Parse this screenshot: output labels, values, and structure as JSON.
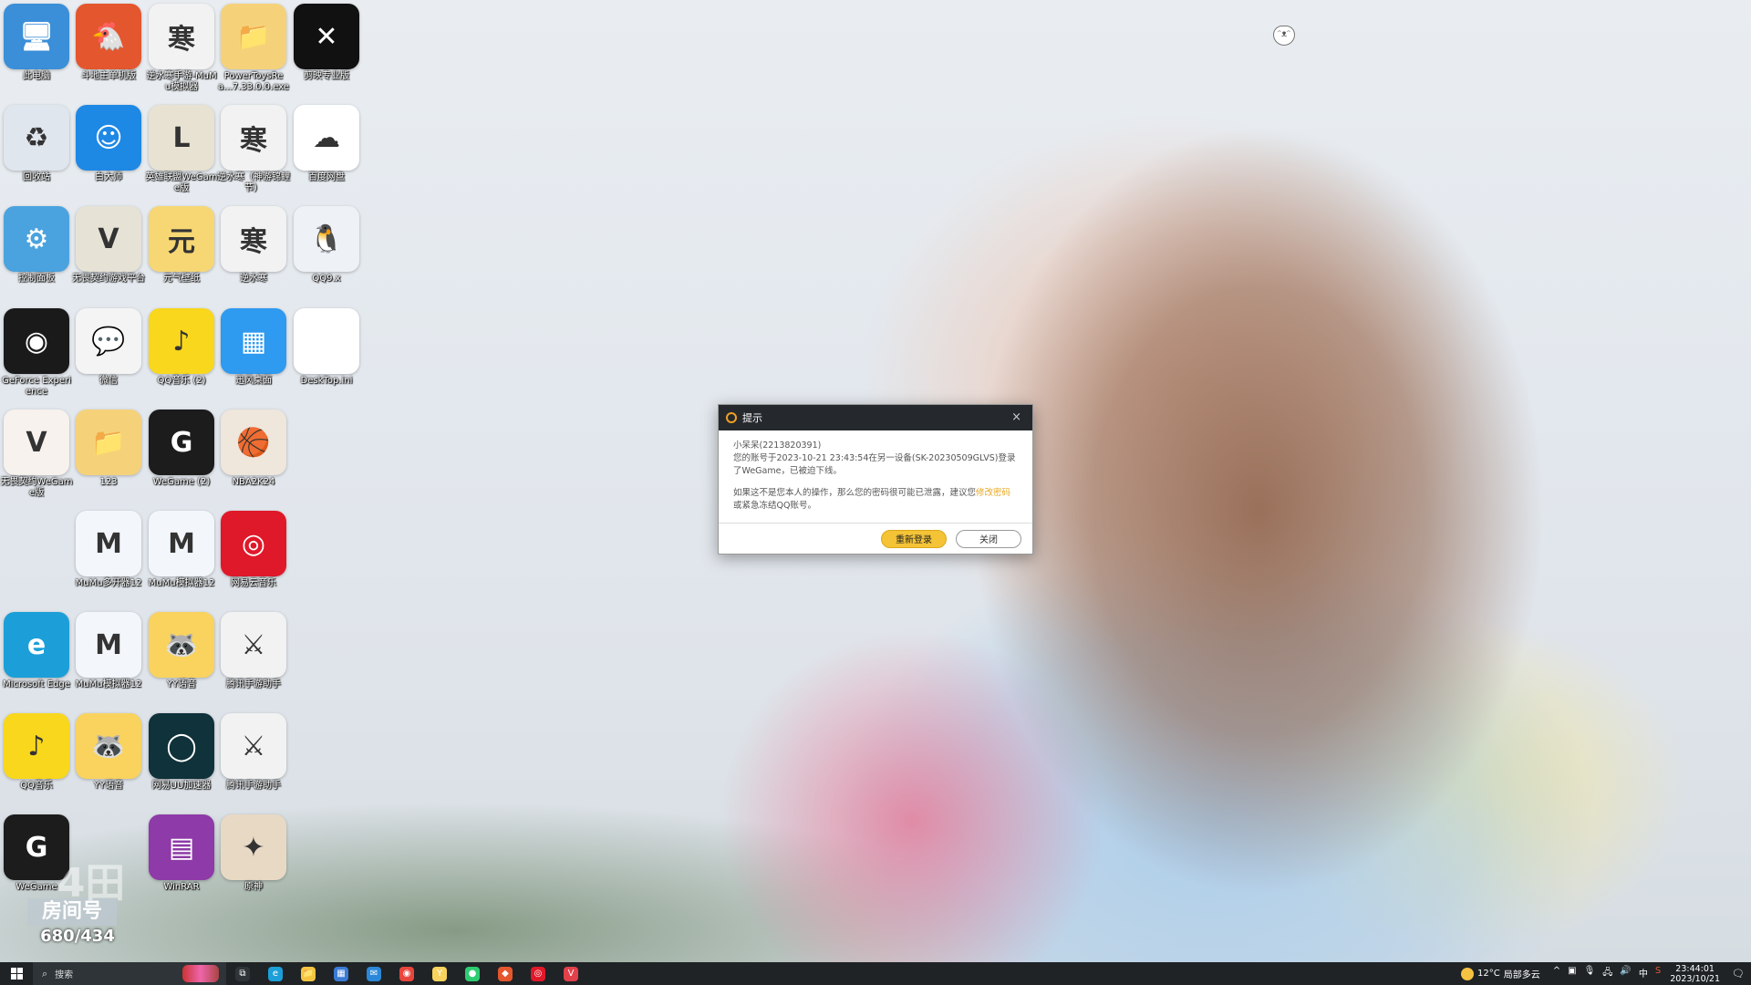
{
  "desktop": {
    "icons": [
      {
        "label": "此电脑",
        "icon": "computer-icon",
        "color": "#3a8fd8",
        "glyph": "🖥"
      },
      {
        "label": "斗地主单机版",
        "icon": "bird-game-icon",
        "color": "#e4572e",
        "glyph": "🐔"
      },
      {
        "label": "逆水寒手游-MuMu模拟器",
        "icon": "nishuihan-icon",
        "color": "#f2f2f2",
        "glyph": "寒"
      },
      {
        "label": "PowerToysRea...7.33.0.0.exe",
        "icon": "folder-icon",
        "color": "#f5d27a",
        "glyph": "📁"
      },
      {
        "label": "剪映专业版",
        "icon": "capcut-icon",
        "color": "#111111",
        "glyph": "✕"
      },
      {
        "label": "回收站",
        "icon": "recycle-bin-icon",
        "color": "#dfe6ee",
        "glyph": "♻"
      },
      {
        "label": "白大师",
        "icon": "white-master-icon",
        "color": "#1e88e5",
        "glyph": "☺"
      },
      {
        "label": "英雄联盟WeGame版",
        "icon": "lol-icon",
        "color": "#e8e2d2",
        "glyph": "L"
      },
      {
        "label": "逆水寒（神游锦鲤节）",
        "icon": "nishuihan-icon",
        "color": "#f2f2f2",
        "glyph": "寒"
      },
      {
        "label": "百度网盘",
        "icon": "baidu-netdisk-icon",
        "color": "#ffffff",
        "glyph": "☁"
      },
      {
        "label": "控制面板",
        "icon": "control-panel-icon",
        "color": "#4aa3df",
        "glyph": "⚙"
      },
      {
        "label": "无畏契约游戏平台",
        "icon": "valorant-platform-icon",
        "color": "#e6e2d6",
        "glyph": "V"
      },
      {
        "label": "元气壁纸",
        "icon": "yuanqi-wallpaper-icon",
        "color": "#f7d774",
        "glyph": "元"
      },
      {
        "label": "逆水寒",
        "icon": "nishuihan-icon",
        "color": "#f2f2f2",
        "glyph": "寒"
      },
      {
        "label": "QQ9.x",
        "icon": "qq-icon",
        "color": "#eef2f6",
        "glyph": "🐧"
      },
      {
        "label": "GeForce Experience",
        "icon": "nvidia-icon",
        "color": "#1a1a1a",
        "glyph": "◉"
      },
      {
        "label": "微信",
        "icon": "wechat-icon",
        "color": "#f4f4f4",
        "glyph": "💬"
      },
      {
        "label": "QQ音乐 (2)",
        "icon": "qq-music-icon",
        "color": "#f9d71c",
        "glyph": "♪"
      },
      {
        "label": "迅风桌面",
        "icon": "tiles-icon",
        "color": "#2e9af0",
        "glyph": "▦"
      },
      {
        "label": "DeskTop.ini",
        "icon": "file-icon",
        "color": "#ffffff",
        "glyph": ""
      },
      {
        "label": "无畏契约WeGame版",
        "icon": "valorant-icon",
        "color": "#f7f2ee",
        "glyph": "V"
      },
      {
        "label": "123",
        "icon": "folder-icon",
        "color": "#f5d27a",
        "glyph": "📁"
      },
      {
        "label": "WeGame (2)",
        "icon": "wegame-icon",
        "color": "#1c1c1c",
        "glyph": "G"
      },
      {
        "label": "NBA2K24",
        "icon": "nba2k-icon",
        "color": "#efe6dc",
        "glyph": "🏀"
      },
      {
        "label": "MuMu多开器12",
        "icon": "mumu-icon",
        "color": "#f3f6fb",
        "glyph": "M"
      },
      {
        "label": "MuMu模拟器12",
        "icon": "mumu-icon",
        "color": "#f3f6fb",
        "glyph": "M"
      },
      {
        "label": "网易云音乐",
        "icon": "netease-music-icon",
        "color": "#e0192a",
        "glyph": "◎"
      },
      {
        "label": "Microsoft Edge",
        "icon": "edge-icon",
        "color": "#1c9fd8",
        "glyph": "e"
      },
      {
        "label": "MuMu模拟器12",
        "icon": "mumu-icon",
        "color": "#f3f6fb",
        "glyph": "M"
      },
      {
        "label": "YY语音",
        "icon": "yy-icon",
        "color": "#f9d35e",
        "glyph": "🦝"
      },
      {
        "label": "腾讯手游助手",
        "icon": "shield-game-icon",
        "color": "#f2f2f2",
        "glyph": "⚔"
      },
      {
        "label": "QQ音乐",
        "icon": "qq-music-icon",
        "color": "#f9d71c",
        "glyph": "♪"
      },
      {
        "label": "YY语音",
        "icon": "yy-icon",
        "color": "#f9d35e",
        "glyph": "🦝"
      },
      {
        "label": "网易UU加速器",
        "icon": "uu-accelerator-icon",
        "color": "#10323a",
        "glyph": "◯"
      },
      {
        "label": "腾讯手游助手",
        "icon": "shield-game-icon",
        "color": "#f2f2f2",
        "glyph": "⚔"
      },
      {
        "label": "WeGame",
        "icon": "wegame-icon",
        "color": "#1c1c1c",
        "glyph": "G"
      },
      {
        "label": "WinRAR",
        "icon": "winrar-icon",
        "color": "#8e3aa8",
        "glyph": "▤"
      },
      {
        "label": "原神",
        "icon": "genshin-icon",
        "color": "#e8d9c4",
        "glyph": "✦"
      }
    ]
  },
  "dialog": {
    "title": "提示",
    "close_glyph": "×",
    "line1": "小呆呆(2213820391)",
    "line2": "您的账号于2023-10-21 23:43:54在另一设备(SK-20230509GLVS)登录了WeGame，已被迫下线。",
    "line3_prefix": "如果这不是您本人的操作，那么您的密码很可能已泄露，建议您",
    "line3_link": "修改密码",
    "line3_suffix": "或紧急冻结QQ账号。",
    "relogin_label": "重新登录",
    "close_label": "关闭",
    "accent_color": "#f5c436"
  },
  "room_watermark": {
    "big_text": "4田",
    "label": "房间号",
    "number": "680/434"
  },
  "taskbar": {
    "search_placeholder": "搜索",
    "apps": [
      {
        "icon": "task-view-icon",
        "glyph": "⧉",
        "color": "#2f3438"
      },
      {
        "icon": "edge-icon",
        "glyph": "e",
        "color": "#1c9fd8"
      },
      {
        "icon": "file-explorer-icon",
        "glyph": "📁",
        "color": "#f5c542"
      },
      {
        "icon": "store-icon",
        "glyph": "▦",
        "color": "#3a7bd5"
      },
      {
        "icon": "mail-icon",
        "glyph": "✉",
        "color": "#2b88d8"
      },
      {
        "icon": "chrome-icon",
        "glyph": "◉",
        "color": "#e8453c"
      },
      {
        "icon": "yy-icon",
        "glyph": "Y",
        "color": "#f9d35e"
      },
      {
        "icon": "wechat-icon",
        "glyph": "●",
        "color": "#2ecc71"
      },
      {
        "icon": "app-icon",
        "glyph": "◆",
        "color": "#e4572e"
      },
      {
        "icon": "netease-music-icon",
        "glyph": "◎",
        "color": "#e0192a"
      },
      {
        "icon": "valorant-icon",
        "glyph": "V",
        "color": "#e2404b"
      }
    ],
    "weather_temp": "12°C",
    "weather_desc": "局部多云",
    "tray_arrow": "^",
    "ime_label": "中",
    "time": "23:44:01",
    "date": "2023/10/21"
  }
}
